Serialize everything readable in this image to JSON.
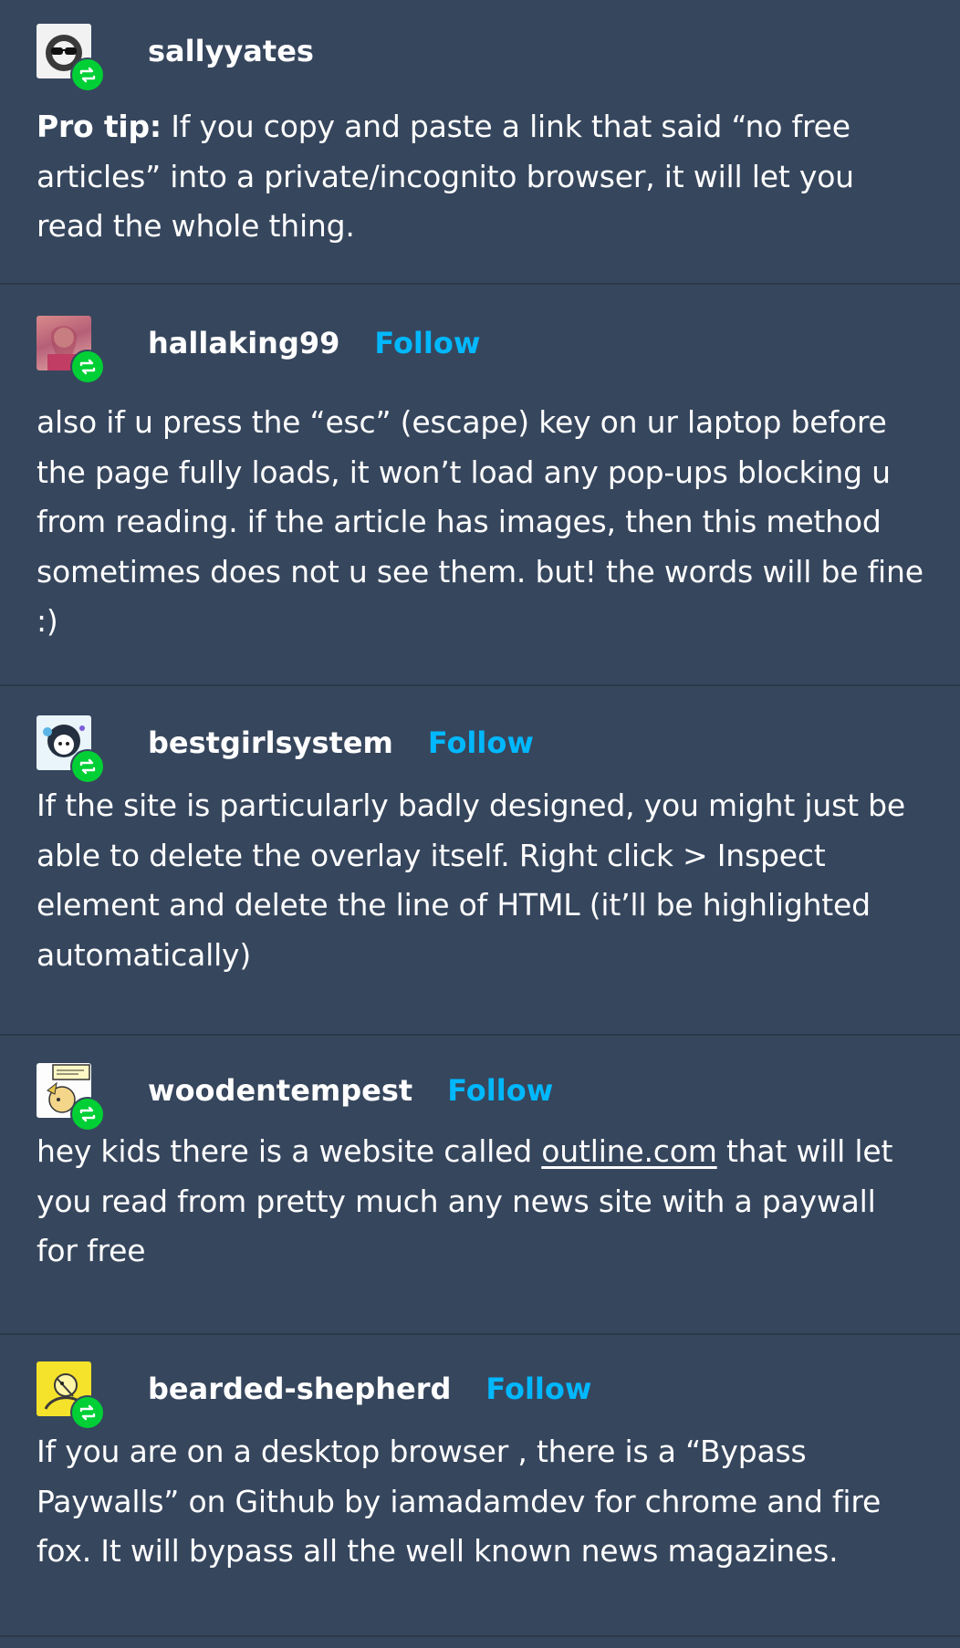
{
  "colors": {
    "background": "#36465d",
    "divider": "#2b3849",
    "follow": "#00b8ff",
    "reblog_badge": "#00cf35",
    "text": "#ffffff"
  },
  "posts": [
    {
      "username": "sallyyates",
      "follow_label": "",
      "avatar_icon": "sunglasses-avatar-icon",
      "badge_icon": "reblog-icon",
      "body_prefix_bold": "Pro tip:",
      "body": " If you copy and paste a link that said “no free articles” into a private/incognito browser, it will let you read the whole thing."
    },
    {
      "username": "hallaking99",
      "follow_label": "Follow",
      "avatar_icon": "photo-avatar-icon",
      "badge_icon": "reblog-icon",
      "body": "also if u press the “esc” (escape) key on ur laptop before the page fully loads, it won’t load any pop-ups blocking u from reading. if the article has images, then this method sometimes does not u see them. but! the words will be fine :)"
    },
    {
      "username": "bestgirlsystem",
      "follow_label": "Follow",
      "avatar_icon": "cartoon-avatar-icon",
      "badge_icon": "reblog-icon",
      "body": "If the site is particularly badly designed, you might just be able to delete the overlay itself. Right click > Inspect element and delete the line of HTML (it’ll be highlighted automatically)"
    },
    {
      "username": "woodentempest",
      "follow_label": "Follow",
      "avatar_icon": "comic-avatar-icon",
      "badge_icon": "reblog-icon",
      "body_before_link": "hey kids there is a website called ",
      "body_link": "outline.com",
      "body_after_link": " that will let you read from pretty much any news site with a paywall for free"
    },
    {
      "username": "bearded-shepherd",
      "follow_label": "Follow",
      "avatar_icon": "yellow-avatar-icon",
      "badge_icon": "reblog-icon",
      "body": "If you are on a desktop browser , there is a “Bypass Paywalls” on Github by  iamadamdev for chrome and fire fox. It will bypass all the well known news magazines."
    }
  ]
}
